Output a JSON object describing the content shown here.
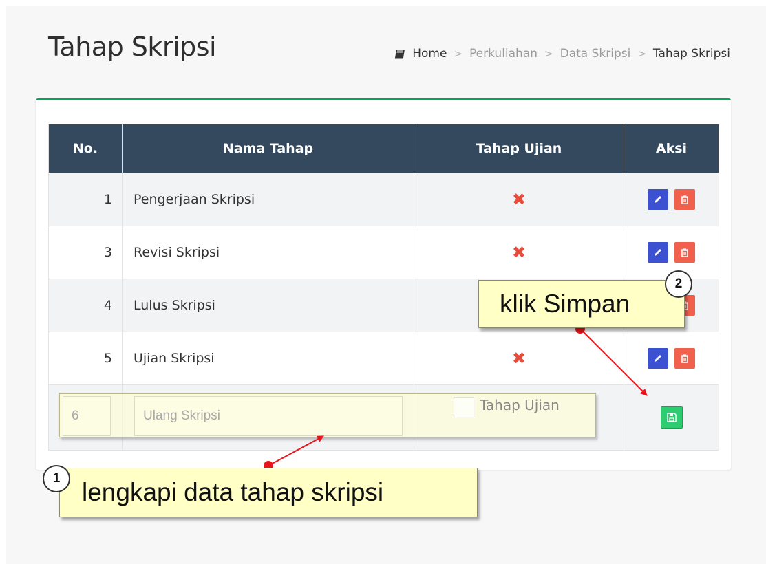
{
  "page": {
    "title": "Tahap Skripsi"
  },
  "breadcrumb": [
    "Home",
    "Perkuliahan",
    "Data Skripsi",
    "Tahap Skripsi"
  ],
  "table": {
    "headers": [
      "No.",
      "Nama Tahap",
      "Tahap Ujian",
      "Aksi"
    ],
    "rows": [
      {
        "no": "1",
        "name": "Pengerjaan Skripsi",
        "ujian": "✖"
      },
      {
        "no": "3",
        "name": "Revisi Skripsi",
        "ujian": "✖"
      },
      {
        "no": "4",
        "name": "Lulus Skripsi",
        "ujian": ""
      },
      {
        "no": "5",
        "name": "Ujian Skripsi",
        "ujian": "✖"
      }
    ]
  },
  "form": {
    "no_placeholder": "6",
    "name_placeholder": "Ulang Skripsi",
    "checkbox_label": "Tahap Ujian"
  },
  "annotations": {
    "callout_1": "lengkapi data tahap skripsi",
    "callout_2": "klik Simpan",
    "num_1": "1",
    "num_2": "2"
  },
  "colors": {
    "header_bg": "#34495e",
    "box_border": "#00a65a",
    "edit_button": "#3b51d1",
    "delete_button": "#f0604d",
    "save_button": "#2ecc71",
    "x_mark": "#e74c3c",
    "callout_bg": "#ffffc6",
    "arrow": "#e8141b"
  },
  "icons": {
    "breadcrumb": "book-icon",
    "edit": "pencil-icon",
    "delete": "trash-icon",
    "save": "floppy-disk-icon",
    "no_exam": "x-mark-icon"
  }
}
